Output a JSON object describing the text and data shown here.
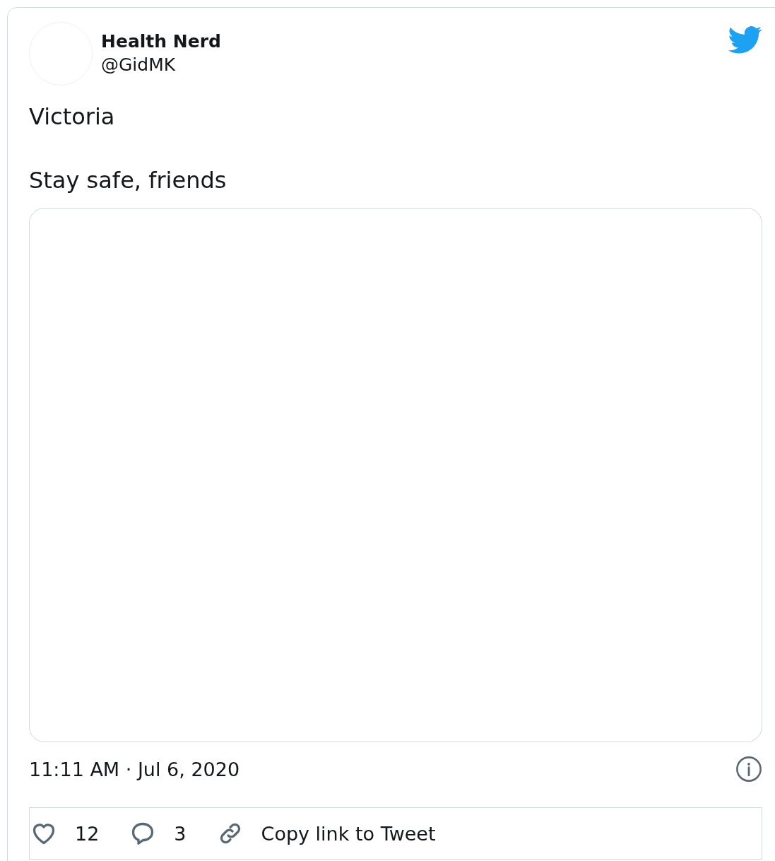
{
  "author": {
    "name": "Health Nerd",
    "handle": "@GidMK"
  },
  "text": [
    "Victoria",
    "Stay safe, friends"
  ],
  "media": {
    "kind": "picture"
  },
  "timestamp": "11:11 AM · Jul 6, 2020",
  "actions": [
    {
      "kind": "like",
      "label": "12"
    },
    {
      "kind": "reply",
      "label": "3"
    },
    {
      "kind": "copy",
      "label": "Copy link to Tweet"
    }
  ]
}
